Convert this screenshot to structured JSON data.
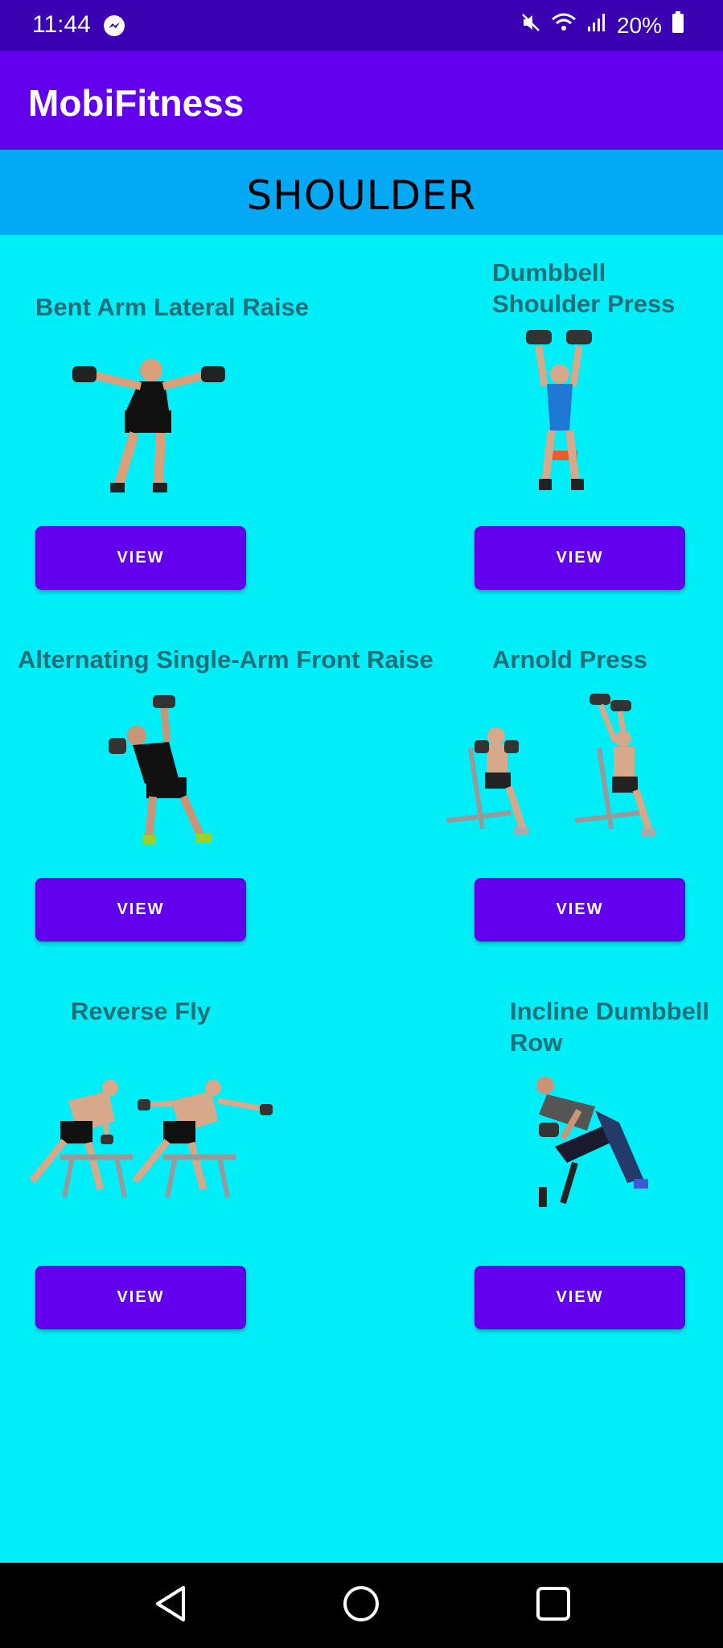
{
  "status_bar": {
    "time": "11:44",
    "battery": "20%",
    "icons": [
      "messenger-icon",
      "mute-icon",
      "wifi-icon",
      "signal-icon",
      "battery-icon"
    ]
  },
  "app_bar": {
    "title": "MobiFitness"
  },
  "section": {
    "title": "SHOULDER"
  },
  "exercises": [
    {
      "title": "Bent Arm Lateral Raise",
      "button": "VIEW"
    },
    {
      "title_line1": "Dumbbell",
      "title_line2": "Shoulder Press",
      "button": "VIEW"
    },
    {
      "title": "Alternating Single-Arm Front Raise",
      "button": "VIEW"
    },
    {
      "title": "Arnold Press",
      "button": "VIEW"
    },
    {
      "title": "Reverse Fly",
      "button": "VIEW"
    },
    {
      "title_line1": "Incline Dumbbell",
      "title_line2": "Row",
      "button": "VIEW"
    }
  ],
  "nav_bar": {
    "icons": [
      "back-icon",
      "home-icon",
      "recents-icon"
    ]
  },
  "colors": {
    "status_bar": "#3A01B2",
    "app_bar": "#6200EE",
    "banner": "#03A9F4",
    "background": "#00EEF7",
    "title_text": "#1F6E78",
    "button": "#6200EE"
  }
}
